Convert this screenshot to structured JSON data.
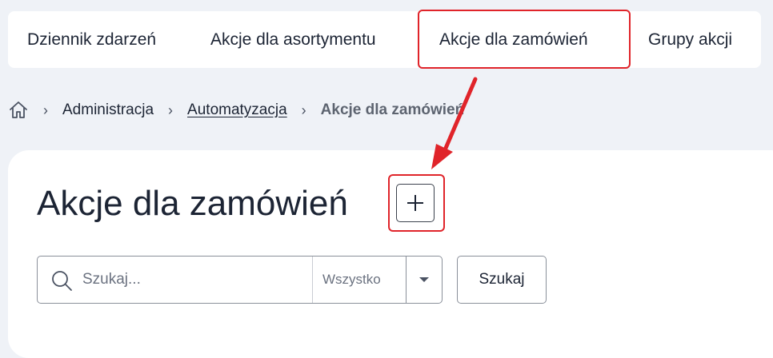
{
  "tabs": [
    {
      "label": "Dziennik zdarzeń"
    },
    {
      "label": "Akcje dla asortymentu"
    },
    {
      "label": "Akcje dla zamówień"
    },
    {
      "label": "Grupy akcji"
    }
  ],
  "breadcrumb": {
    "home_icon": "home-icon",
    "items": [
      {
        "label": "Administracja"
      },
      {
        "label": "Automatyzacja"
      },
      {
        "label": "Akcje dla zamówień"
      }
    ],
    "separator": "›"
  },
  "page": {
    "title": "Akcje dla zamówień",
    "add_button_icon": "plus-icon"
  },
  "search": {
    "placeholder": "Szukaj...",
    "value": "",
    "filter_selected": "Wszystko",
    "button_label": "Szukaj"
  },
  "colors": {
    "accent_highlight": "#e0242a",
    "text": "#1c2434",
    "background": "#eff2f7"
  }
}
